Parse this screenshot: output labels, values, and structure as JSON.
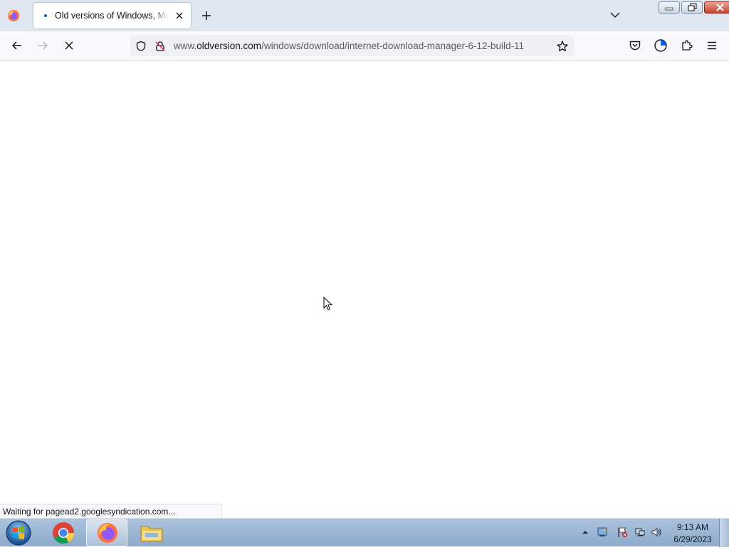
{
  "browser": {
    "tab": {
      "title": "Old versions of Windows, Mac",
      "close_label": "Close Tab"
    },
    "new_tab_label": "Open a new tab",
    "list_tabs_label": "List all tabs",
    "window_buttons": {
      "minimize": "Minimize",
      "restore": "Restore Down",
      "close": "Close"
    },
    "nav": {
      "back_label": "Back",
      "forward_label": "Forward",
      "stop_label": "Stop"
    },
    "url": {
      "prefix": "www.",
      "host": "oldversion.com",
      "path": "/windows/download/internet-download-manager-6-12-build-11"
    },
    "toolbar": {
      "bookmark_label": "Bookmark this page",
      "pocket_label": "Save to Pocket",
      "account_label": "Firefox View",
      "extensions_label": "Extensions",
      "menu_label": "Open application menu"
    },
    "status_text": "Waiting for pagead2.googlesyndication.com..."
  },
  "taskbar": {
    "start_label": "Start",
    "apps": [
      {
        "name": "Google Chrome",
        "active": false
      },
      {
        "name": "Firefox",
        "active": true
      },
      {
        "name": "Windows Explorer",
        "active": false
      }
    ],
    "clock": {
      "time": "9:13 AM",
      "date": "6/29/2023"
    }
  },
  "colors": {
    "tabbar_bg": "#dfe6ef",
    "toolbar_bg": "#f9f9fb",
    "accent": "#0061e0",
    "taskbar_bg": "#9db7d4"
  }
}
